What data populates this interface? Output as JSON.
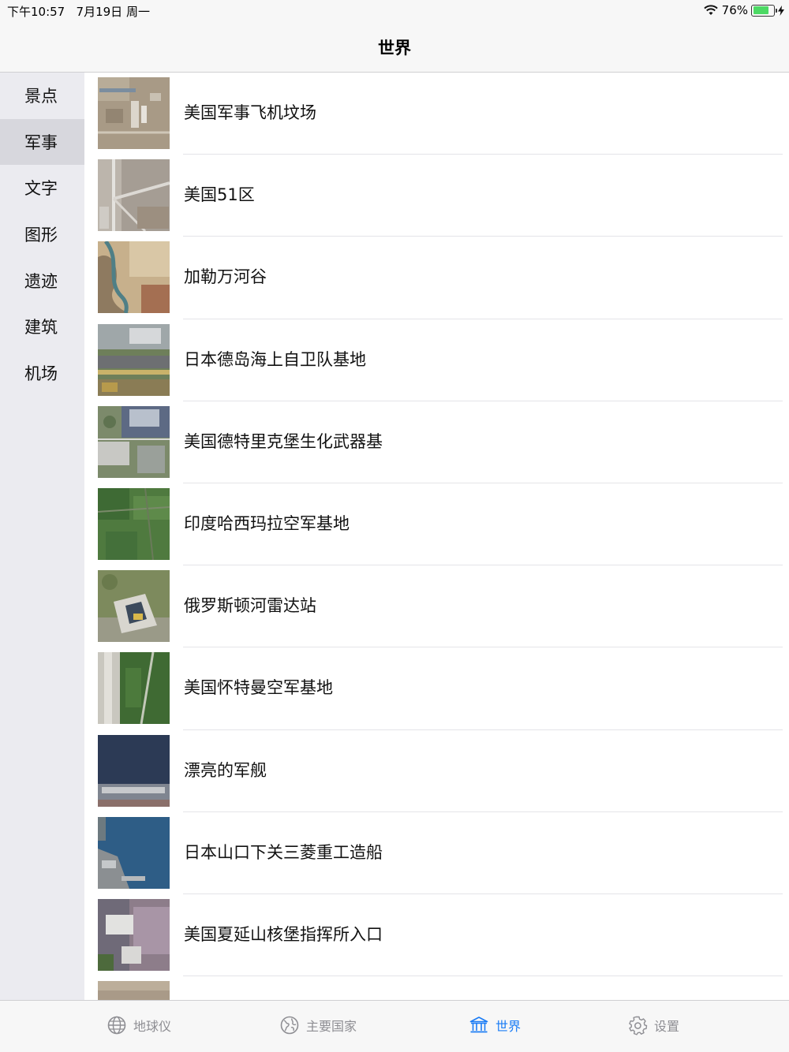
{
  "status": {
    "time": "下午10:57",
    "date": "7月19日 周一",
    "battery": "76%",
    "battery_level": 0.76
  },
  "nav": {
    "title": "世界"
  },
  "sidebar": {
    "items": [
      {
        "label": "景点"
      },
      {
        "label": "军事",
        "selected": true
      },
      {
        "label": "文字"
      },
      {
        "label": "图形"
      },
      {
        "label": "遗迹"
      },
      {
        "label": "建筑"
      },
      {
        "label": "机场"
      }
    ]
  },
  "list": {
    "items": [
      {
        "label": "美国军事飞机坟场"
      },
      {
        "label": "美国51区"
      },
      {
        "label": "加勒万河谷"
      },
      {
        "label": "日本德岛海上自卫队基地"
      },
      {
        "label": "美国德特里克堡生化武器基"
      },
      {
        "label": "印度哈西玛拉空军基地"
      },
      {
        "label": "俄罗斯顿河雷达站"
      },
      {
        "label": "美国怀特曼空军基地"
      },
      {
        "label": "漂亮的军舰"
      },
      {
        "label": "日本山口下关三菱重工造船"
      },
      {
        "label": "美国夏延山核堡指挥所入口"
      },
      {
        "label": ""
      }
    ]
  },
  "tabs": [
    {
      "label": "地球仪",
      "icon": "globe-icon"
    },
    {
      "label": "主要国家",
      "icon": "world-map-icon"
    },
    {
      "label": "世界",
      "icon": "museum-icon",
      "active": true
    },
    {
      "label": "设置",
      "icon": "gear-icon"
    }
  ],
  "colors": {
    "accent": "#1a7cf5",
    "sidebar_bg": "#ebebf0",
    "sidebar_selected": "#d7d7dd",
    "tab_inactive": "#8e8e93"
  }
}
